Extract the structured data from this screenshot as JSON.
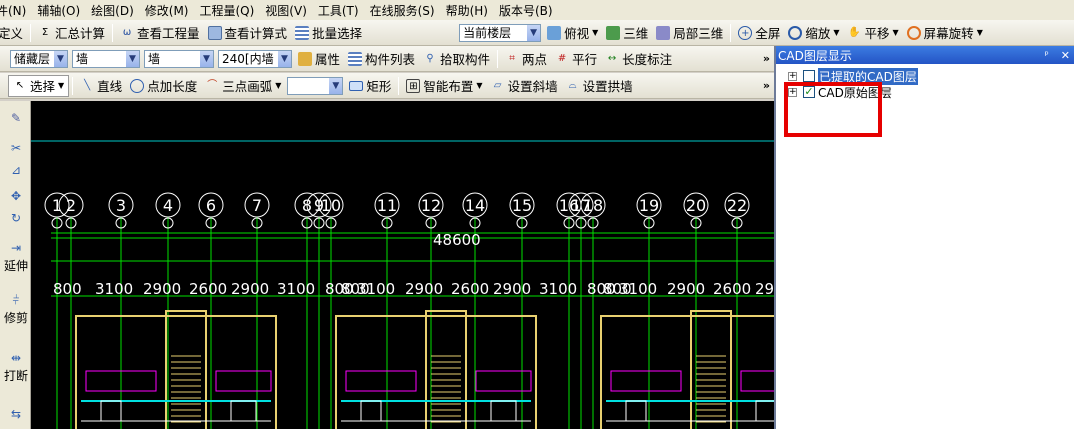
{
  "menu": [
    "件(N)",
    "辅轴(O)",
    "绘图(D)",
    "修改(M)",
    "工程量(Q)",
    "视图(V)",
    "工具(T)",
    "在线服务(S)",
    "帮助(H)",
    "版本号(B)"
  ],
  "toolbar1": {
    "define": "定义",
    "summary": "汇总计算",
    "view_quantity": "查看工程量",
    "view_formula": "查看计算式",
    "batch_select": "批量选择",
    "more": "»"
  },
  "toolbar1b": {
    "floor": "当前楼层",
    "top_view": "俯视",
    "three_d": "三维",
    "local_3d": "局部三维",
    "fullscreen": "全屏",
    "zoom": "缩放",
    "pan": "平移",
    "rotate": "屏幕旋转"
  },
  "toolbar2": {
    "layer": "储藏层",
    "category": "墙",
    "type": "墙",
    "size": "240[内墙",
    "properties": "属性",
    "component_list": "构件列表",
    "pick_component": "拾取构件",
    "two_points": "两点",
    "parallel": "平行",
    "length_mark": "长度标注",
    "more": "»"
  },
  "toolbar3": {
    "select": "选择",
    "line": "直线",
    "point_length": "点加长度",
    "arc": "三点画弧",
    "combo_value": "",
    "rectangle": "矩形",
    "smart_layout": "智能布置",
    "sloped_wall": "设置斜墙",
    "arch_wall": "设置拱墙",
    "more": "»"
  },
  "left_tools": {
    "extend": "延伸",
    "trim": "修剪",
    "break": "打断"
  },
  "cad": {
    "axis_labels": [
      "1",
      "2",
      "3",
      "4",
      "6",
      "7",
      "8",
      "9",
      "10",
      "11",
      "12",
      "14",
      "15",
      "16",
      "17",
      "18",
      "19",
      "20",
      "22"
    ],
    "total_dimension": "48600",
    "dimensions": [
      "800",
      "3100",
      "2900",
      "2600",
      "2900",
      "3100",
      "800",
      "800",
      "3100",
      "2900",
      "2600",
      "2900",
      "3100",
      "800",
      "800",
      "3100",
      "2900",
      "2600",
      "29"
    ]
  },
  "cad_panel": {
    "title": "CAD图层显示",
    "pin": "ᵖ",
    "close": "✕",
    "layers": [
      {
        "label": "已提取的CAD图层",
        "checked": false
      },
      {
        "label": "CAD原始图层",
        "checked": true
      }
    ]
  },
  "colors": {
    "highlight_box": "#e60000",
    "axis_green": "#00e000",
    "wall_yellow": "#e8d070",
    "magenta": "#ff00ff",
    "cyan": "#00e0e0"
  }
}
